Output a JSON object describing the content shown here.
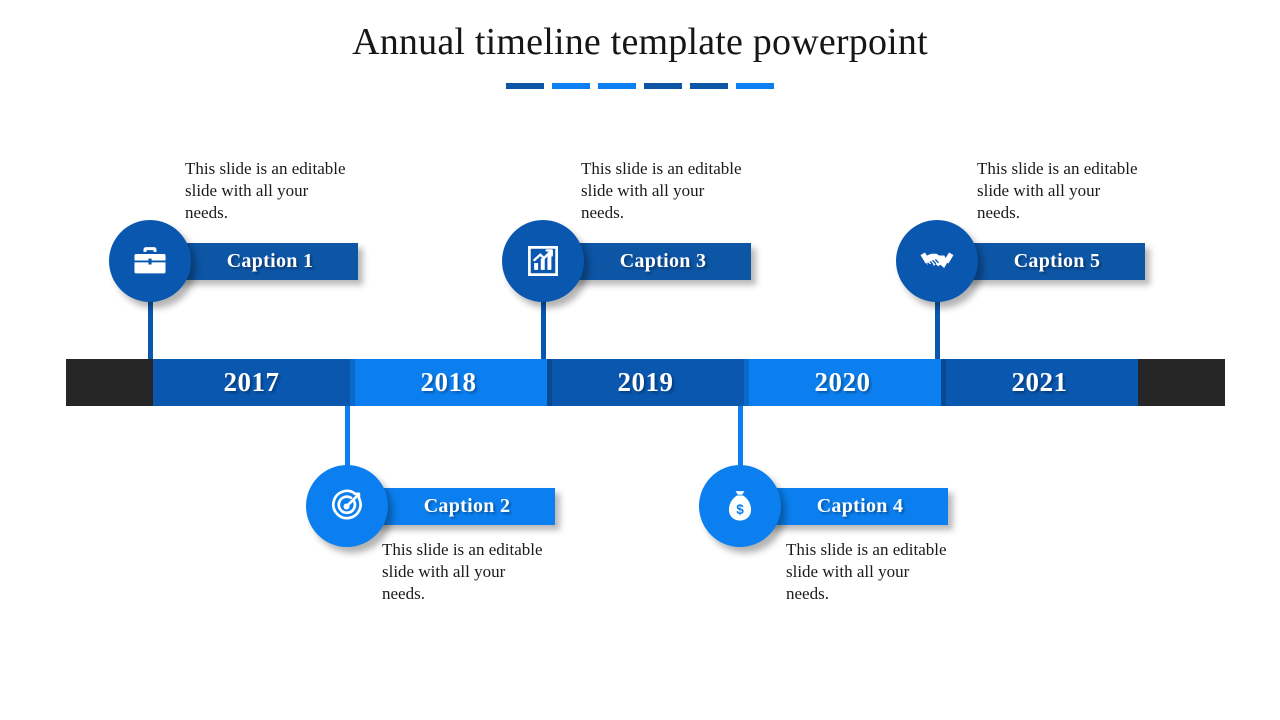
{
  "title": "Annual timeline template powerpoint",
  "title_dashes": [
    {
      "color": "#0d55a5"
    },
    {
      "color": "#0c80f2"
    },
    {
      "color": "#0c80f2"
    },
    {
      "color": "#0d55a5"
    },
    {
      "color": "#0d55a5"
    },
    {
      "color": "#0c80f2"
    }
  ],
  "colors": {
    "dark_blue": "#0a57b0",
    "bright_blue": "#0b7fef",
    "bar_end_cap": "#262626",
    "text_dark": "#1a1a1a",
    "white": "#ffffff"
  },
  "timeline": {
    "end_cap_left": "",
    "end_cap_right": "",
    "segments": [
      {
        "year": "2017",
        "shade": "dark"
      },
      {
        "year": "2018",
        "shade": "light"
      },
      {
        "year": "2019",
        "shade": "dark"
      },
      {
        "year": "2020",
        "shade": "light"
      },
      {
        "year": "2021",
        "shade": "dark"
      }
    ]
  },
  "items": [
    {
      "caption": "Caption 1",
      "description": "This slide is an editable slide with all your needs.",
      "icon": "briefcase-icon",
      "shade": "dark",
      "position": "above"
    },
    {
      "caption": "Caption 2",
      "description": "This slide is an editable slide with all your needs.",
      "icon": "target-icon",
      "shade": "light",
      "position": "below"
    },
    {
      "caption": "Caption 3",
      "description": "This slide is an editable slide with all your needs.",
      "icon": "bar-chart-icon",
      "shade": "dark",
      "position": "above"
    },
    {
      "caption": "Caption 4",
      "description": "This slide is an editable slide with all your needs.",
      "icon": "money-bag-icon",
      "shade": "light",
      "position": "below"
    },
    {
      "caption": "Caption 5",
      "description": "This slide is an editable slide with all your needs.",
      "icon": "handshake-icon",
      "shade": "dark",
      "position": "above"
    }
  ]
}
